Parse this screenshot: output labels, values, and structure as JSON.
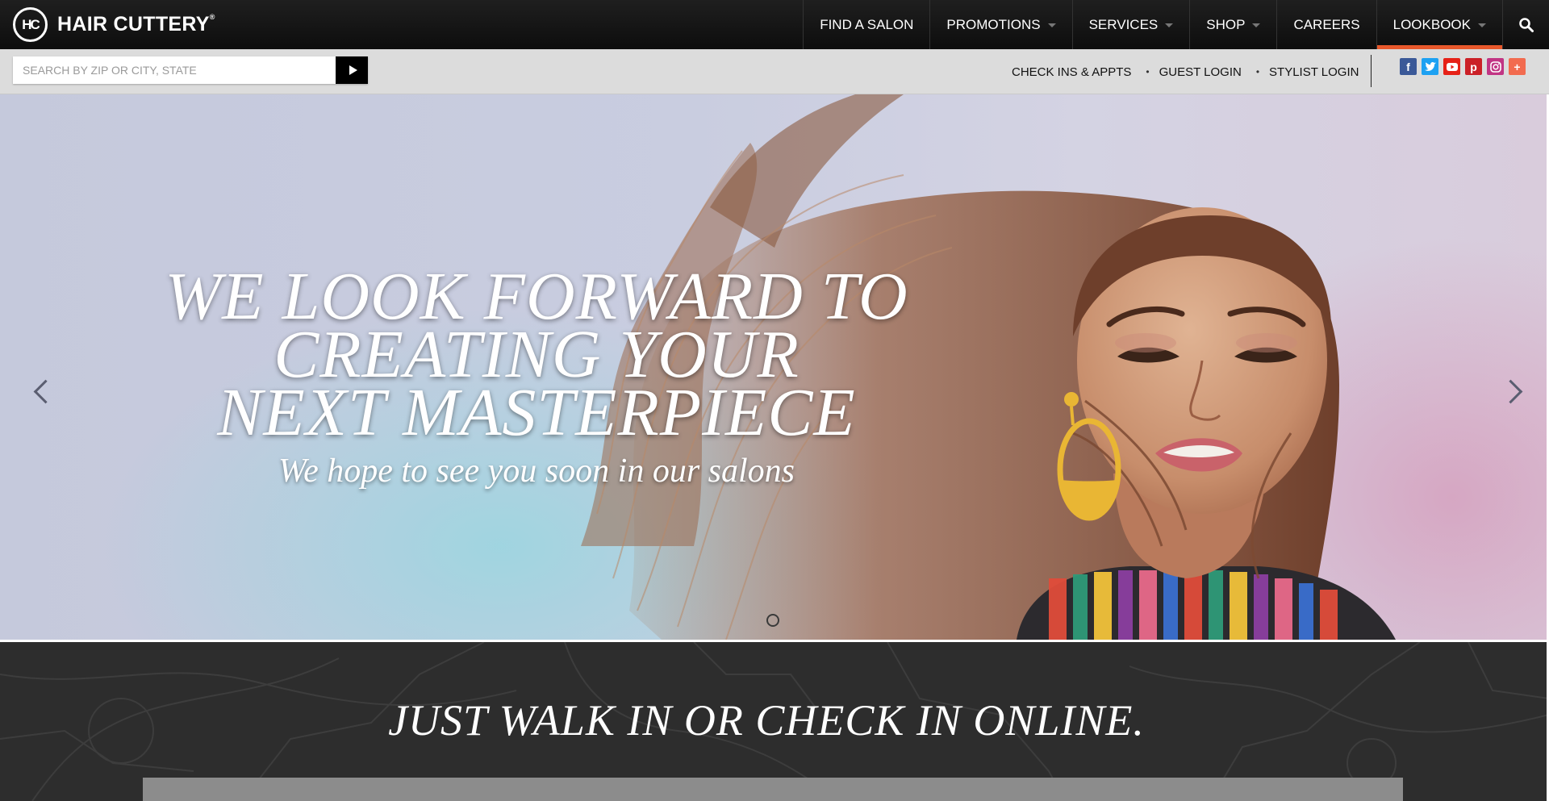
{
  "brand": {
    "badge": "HC",
    "name": "HAIR CUTTERY",
    "mark": "®"
  },
  "nav": {
    "items": [
      {
        "label": "FIND A SALON",
        "dropdown": false
      },
      {
        "label": "PROMOTIONS",
        "dropdown": true
      },
      {
        "label": "SERVICES",
        "dropdown": true
      },
      {
        "label": "SHOP",
        "dropdown": true
      },
      {
        "label": "CAREERS",
        "dropdown": false
      },
      {
        "label": "LOOKBOOK",
        "dropdown": true,
        "active": true
      }
    ],
    "search_icon": "search-icon",
    "active_color": "#e8582b"
  },
  "utility": {
    "search": {
      "placeholder": "SEARCH BY ZIP OR CITY, STATE",
      "value": ""
    },
    "links": [
      "CHECK INS & APPTS",
      "GUEST LOGIN",
      "STYLIST LOGIN"
    ],
    "social": [
      {
        "name": "facebook-icon",
        "glyph": "f",
        "color": "#3b5998"
      },
      {
        "name": "twitter-icon",
        "glyph": "t",
        "color": "#1da1f2"
      },
      {
        "name": "youtube-icon",
        "glyph": "▶",
        "color": "#e62117"
      },
      {
        "name": "pinterest-icon",
        "glyph": "p",
        "color": "#cb2027"
      },
      {
        "name": "instagram-icon",
        "glyph": "◎",
        "color": "#c13584"
      },
      {
        "name": "more-icon",
        "glyph": "+",
        "color": "#f26b4f"
      }
    ]
  },
  "hero": {
    "headline": [
      "WE LOOK FORWARD TO",
      "CREATING YOUR",
      "NEXT MASTERPIECE"
    ],
    "subheadline": "We hope to see you soon in our salons"
  },
  "band": {
    "title": "JUST WALK IN OR CHECK IN ONLINE."
  }
}
